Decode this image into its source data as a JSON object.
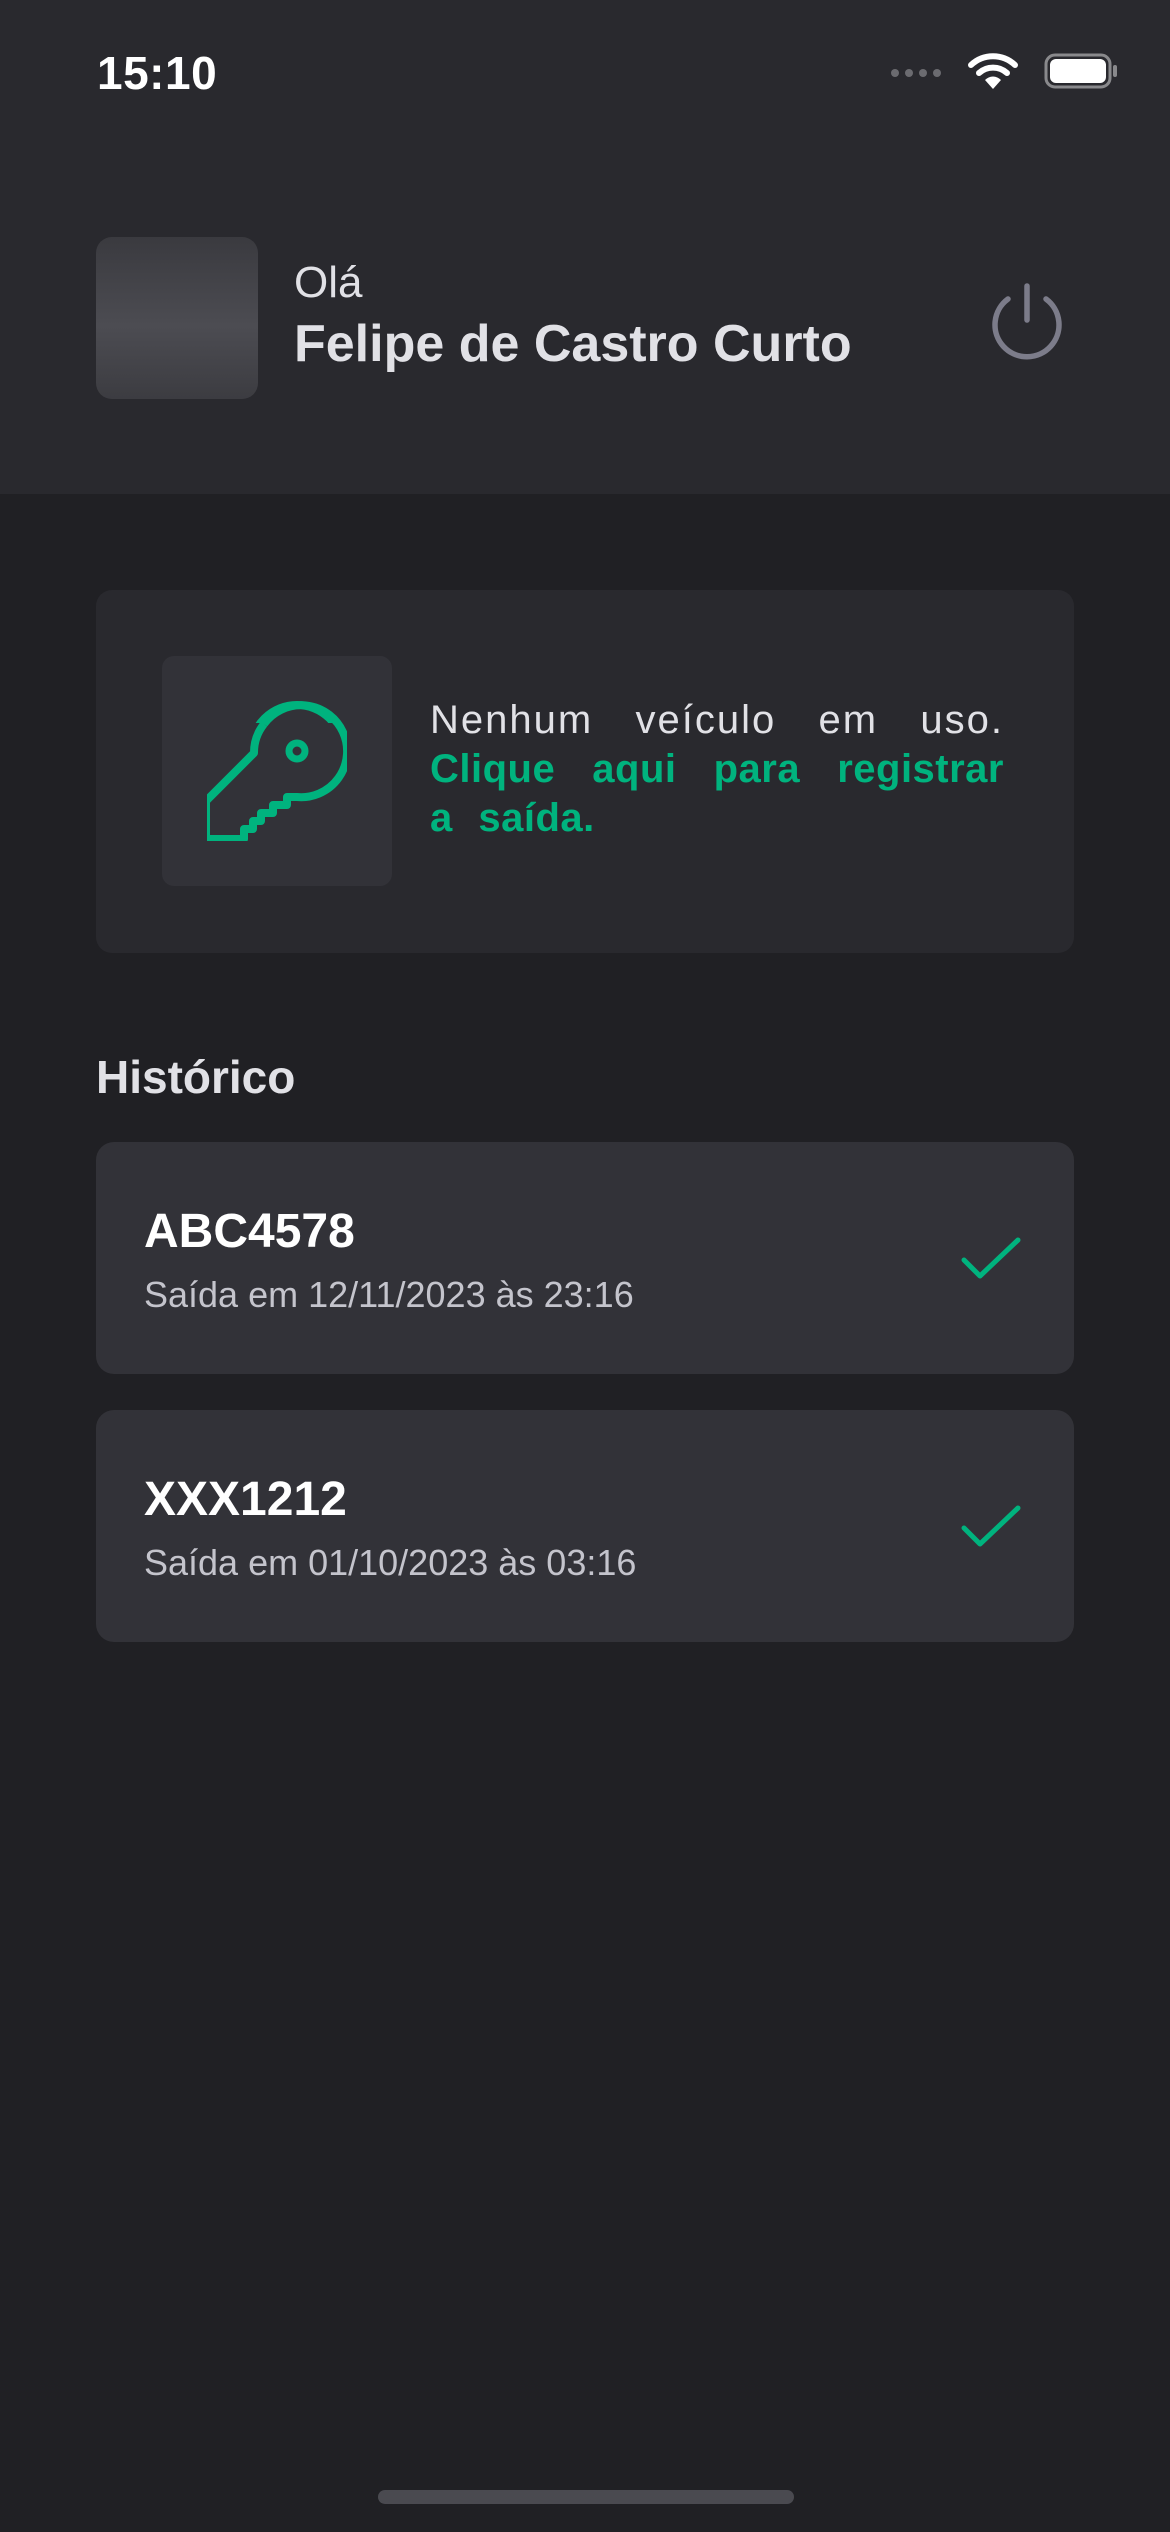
{
  "status_bar": {
    "time": "15:10",
    "icons": [
      "signal-icon",
      "wifi-icon",
      "battery-icon"
    ]
  },
  "header": {
    "greeting": "Olá",
    "user_name": "Felipe de Castro Curto",
    "logout_icon": "power-icon"
  },
  "vehicle_card": {
    "icon": "key-icon",
    "status_text": "Nenhum veículo em uso.",
    "action_text": "Clique aqui para registrar a saída."
  },
  "history": {
    "title": "Histórico",
    "items": [
      {
        "plate": "ABC4578",
        "exit": "Saída em 12/11/2023 às 23:16",
        "icon": "check-icon"
      },
      {
        "plate": "XXX1212",
        "exit": "Saída em 01/10/2023 às 03:16",
        "icon": "check-icon"
      }
    ]
  },
  "colors": {
    "background": "#202024",
    "surface": "#29292e",
    "card": "#323238",
    "accent": "#00b37e",
    "text": "#e1e1e6",
    "muted": "#c4c4cc"
  }
}
